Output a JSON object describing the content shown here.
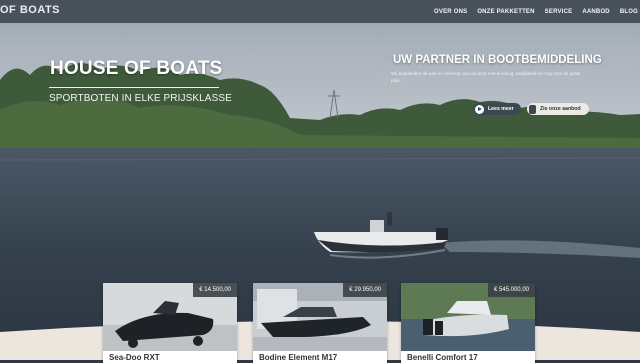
{
  "nav": {
    "logo": "OF BOATS",
    "items": [
      {
        "label": "OVER ONS"
      },
      {
        "label": "ONZE PAKKETTEN"
      },
      {
        "label": "SERVICE"
      },
      {
        "label": "AANBOD"
      },
      {
        "label": "BLOG"
      }
    ]
  },
  "hero": {
    "title": "HOUSE OF BOATS",
    "subtitle": "SPORTBOTEN IN ELKE PRIJSKLASSE",
    "right_title": "UW PARTNER IN BOOTBEMIDDELING",
    "right_text": "Wij begeleiden de aan en verkoop van uw boot met ervaring, eerlijkheid en oog voor de juiste prijs.",
    "btn_more": "Lees meer",
    "btn_offer": "Zie onze aanbod"
  },
  "cards": [
    {
      "price": "€ 14.500,00",
      "name": "Sea-Doo RXT"
    },
    {
      "price": "€ 29.950,00",
      "name": "Bodine Element M17"
    },
    {
      "price": "€ 545.000,00",
      "name": "Benelli Comfort 17"
    }
  ],
  "colors": {
    "nav_bg": "#3c464e",
    "button_dark": "#3b4852",
    "button_light": "#eceae4",
    "band": "#ece6df"
  }
}
